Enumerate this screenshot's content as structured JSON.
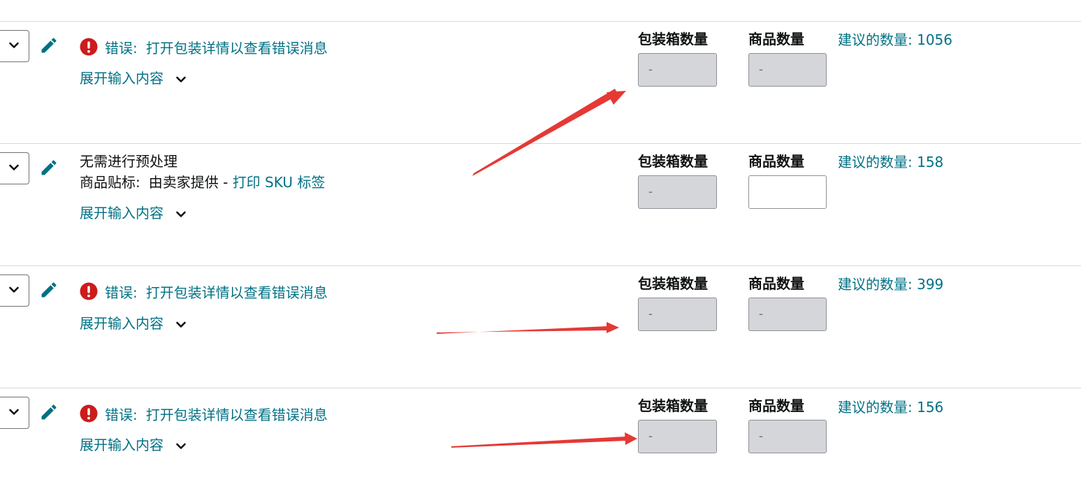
{
  "columns": {
    "box_quantity_label": "包装箱数量",
    "unit_quantity_label": "商品数量",
    "suggested_prefix": "建议的数量: "
  },
  "colors": {
    "link": "#007185",
    "error": "#cc1c1c",
    "annotation_arrow": "#e53935",
    "disabled_field": "#d5d6d9"
  },
  "rows": [
    {
      "status_type": "error",
      "error_label": "错误:",
      "error_link": "打开包装详情以查看错误消息",
      "expand_label": "展开输入内容",
      "box_qty_value": "-",
      "unit_qty_value": "-",
      "unit_qty_enabled": false,
      "suggested_qty": "1056"
    },
    {
      "status_type": "prep",
      "prep_text": "无需进行预处理",
      "sticker_prefix": "商品贴标:",
      "sticker_text": "由卖家提供 - ",
      "sticker_link": "打印 SKU 标签",
      "expand_label": "展开输入内容",
      "box_qty_value": "-",
      "unit_qty_value": "",
      "unit_qty_enabled": true,
      "suggested_qty": "158"
    },
    {
      "status_type": "error",
      "error_label": "错误:",
      "error_link": "打开包装详情以查看错误消息",
      "expand_label": "展开输入内容",
      "box_qty_value": "-",
      "unit_qty_value": "-",
      "unit_qty_enabled": false,
      "suggested_qty": "399"
    },
    {
      "status_type": "error",
      "error_label": "错误:",
      "error_link": "打开包装详情以查看错误消息",
      "expand_label": "展开输入内容",
      "box_qty_value": "-",
      "unit_qty_value": "-",
      "unit_qty_enabled": false,
      "suggested_qty": "156"
    }
  ],
  "icons": {
    "dropdown": "chevron-down-icon",
    "edit": "pencil-icon",
    "error": "exclamation-circle-icon",
    "expand": "chevron-down-icon"
  }
}
